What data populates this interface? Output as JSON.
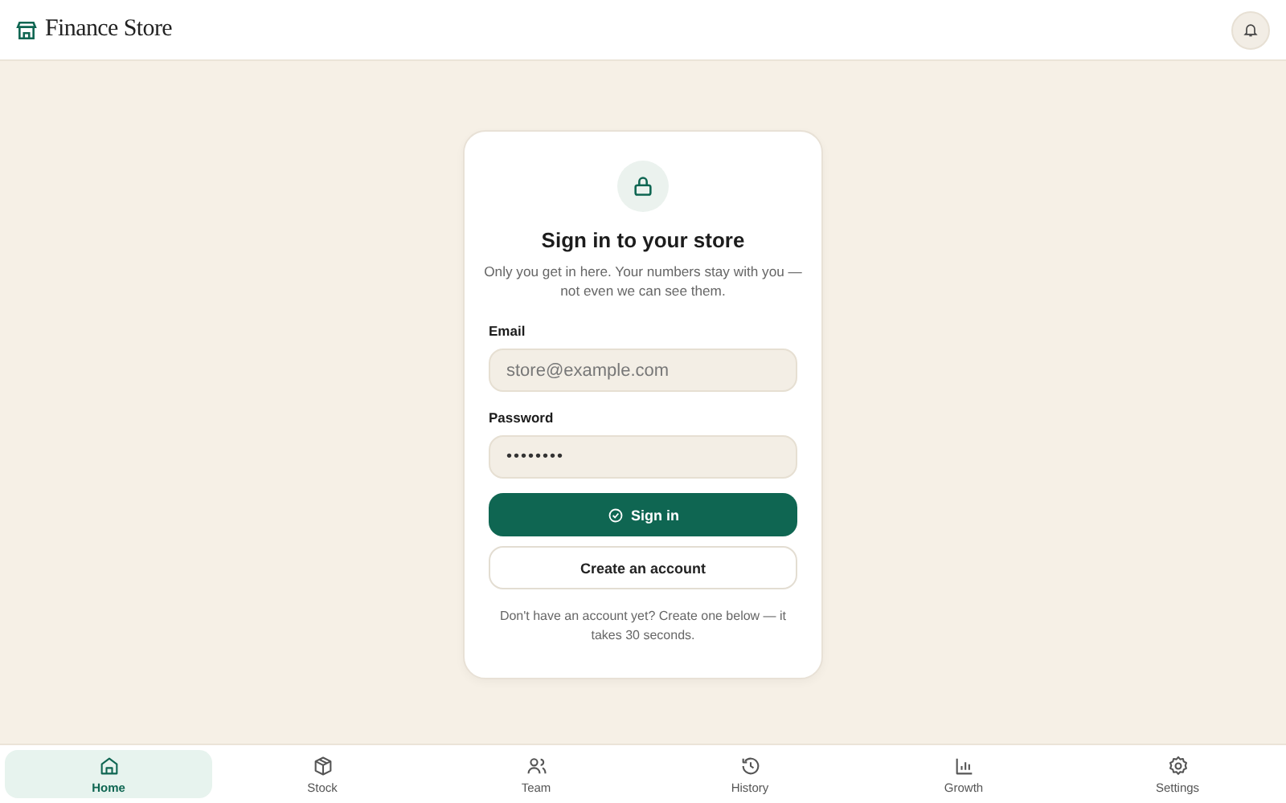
{
  "header": {
    "title": "Finance Store"
  },
  "card": {
    "title": "Sign in to your store",
    "subtitle": "Only you get in here. Your numbers stay with you — not even we can see them.",
    "fields": [
      {
        "label": "Email",
        "placeholder": "store@example.com"
      },
      {
        "label": "Password",
        "value": "••••••••"
      }
    ],
    "primary_button": "Sign in",
    "secondary_button": "Create an account",
    "footnote": "Don't have an account yet? Create one below — it takes 30 seconds."
  },
  "nav": [
    {
      "label": "Home",
      "selected": true
    },
    {
      "label": "Stock",
      "selected": false
    },
    {
      "label": "Team",
      "selected": false
    },
    {
      "label": "History",
      "selected": false
    },
    {
      "label": "Growth",
      "selected": false
    },
    {
      "label": "Settings",
      "selected": false
    }
  ]
}
